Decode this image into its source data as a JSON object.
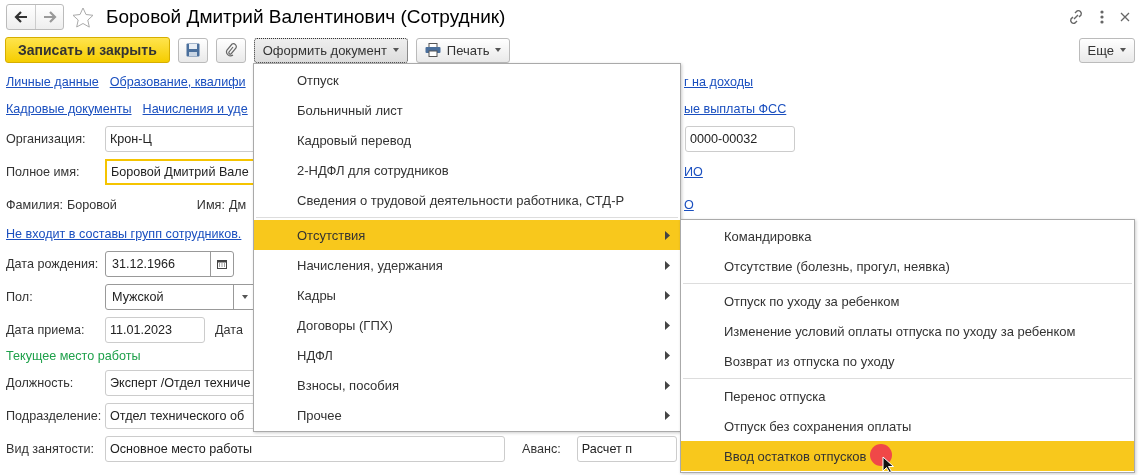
{
  "window": {
    "title": "Боровой Дмитрий Валентинович (Сотрудник)",
    "nav": [
      {
        "kind": "back",
        "disabled": false
      },
      {
        "kind": "forward",
        "disabled": true
      }
    ]
  },
  "toolbar": {
    "save_close": "Записать и закрыть",
    "create_document": "Оформить документ",
    "print": "Печать",
    "more": "Еще"
  },
  "form": [
    {
      "kind": "links",
      "links": [
        "Личные данные",
        "Образование, квалифи"
      ],
      "right_link": "г на доходы"
    },
    {
      "kind": "links",
      "links": [
        "Кадровые документы",
        "Начисления и уде"
      ],
      "right_link": "ые выплаты ФСС"
    },
    {
      "kind": "field",
      "label": "Организация:",
      "value": "Крон-Ц",
      "focused": false,
      "right_field": "0000-00032"
    },
    {
      "kind": "field",
      "label": "Полное имя:",
      "value": "Боровой Дмитрий Вале",
      "focused": true,
      "right_link": "ИО"
    },
    {
      "kind": "pairs",
      "items": [
        {
          "label": "Фамилия:",
          "value": "Боровой"
        },
        {
          "label": "Имя:",
          "value": "Дм"
        }
      ],
      "right_link": "О"
    },
    {
      "kind": "link",
      "text": "Не входит в составы групп сотрудников."
    },
    {
      "kind": "date",
      "label": "Дата рождения:",
      "value": "31.12.1966"
    },
    {
      "kind": "select",
      "label": "Пол:",
      "value": "Мужской"
    },
    {
      "kind": "date_plain",
      "label": "Дата приема:",
      "value": "11.01.2023",
      "after_label": "Дата"
    },
    {
      "kind": "section",
      "text": "Текущее место работы"
    },
    {
      "kind": "field",
      "label": "Должность:",
      "value": "Эксперт /Отдел техниче",
      "focused": false
    },
    {
      "kind": "field",
      "label": "Подразделение:",
      "value": "Отдел технического об",
      "focused": false
    },
    {
      "kind": "field_pair",
      "label": "Вид занятости:",
      "value": "Основное место работы",
      "second_label": "Аванс:",
      "second_value": "Расчет п"
    }
  ],
  "document_menu": {
    "groups": [
      {
        "items": [
          {
            "label": "Отпуск",
            "kind": "command",
            "selected": false
          },
          {
            "label": "Больничный лист",
            "kind": "command",
            "selected": false
          },
          {
            "label": "Кадровый перевод",
            "kind": "command",
            "selected": false
          },
          {
            "label": "2-НДФЛ для сотрудников",
            "kind": "command",
            "selected": false
          },
          {
            "label": "Сведения о трудовой деятельности работника, СТД-Р",
            "kind": "command",
            "selected": false
          }
        ]
      },
      {
        "items": [
          {
            "label": "Отсутствия",
            "kind": "submenu",
            "selected": true
          },
          {
            "label": "Начисления, удержания",
            "kind": "submenu",
            "selected": false
          },
          {
            "label": "Кадры",
            "kind": "submenu",
            "selected": false
          },
          {
            "label": "Договоры (ГПХ)",
            "kind": "submenu",
            "selected": false
          },
          {
            "label": "НДФЛ",
            "kind": "submenu",
            "selected": false
          },
          {
            "label": "Взносы, пособия",
            "kind": "submenu",
            "selected": false
          },
          {
            "label": "Прочее",
            "kind": "submenu",
            "selected": false
          }
        ]
      }
    ]
  },
  "submenu": {
    "groups": [
      {
        "items": [
          {
            "label": "Командировка",
            "kind": "command",
            "selected": false
          },
          {
            "label": "Отсутствие (болезнь, прогул, неявка)",
            "kind": "command",
            "selected": false
          }
        ]
      },
      {
        "items": [
          {
            "label": "Отпуск по уходу за ребенком",
            "kind": "command",
            "selected": false
          },
          {
            "label": "Изменение условий оплаты отпуска по уходу за ребенком",
            "kind": "command",
            "selected": false
          },
          {
            "label": "Возврат из отпуска по уходу",
            "kind": "command",
            "selected": false
          }
        ]
      },
      {
        "items": [
          {
            "label": "Перенос отпуска",
            "kind": "command",
            "selected": false
          },
          {
            "label": "Отпуск без сохранения оплаты",
            "kind": "command",
            "selected": false
          },
          {
            "label": "Ввод остатков отпусков",
            "kind": "command",
            "selected": true
          }
        ]
      }
    ]
  }
}
